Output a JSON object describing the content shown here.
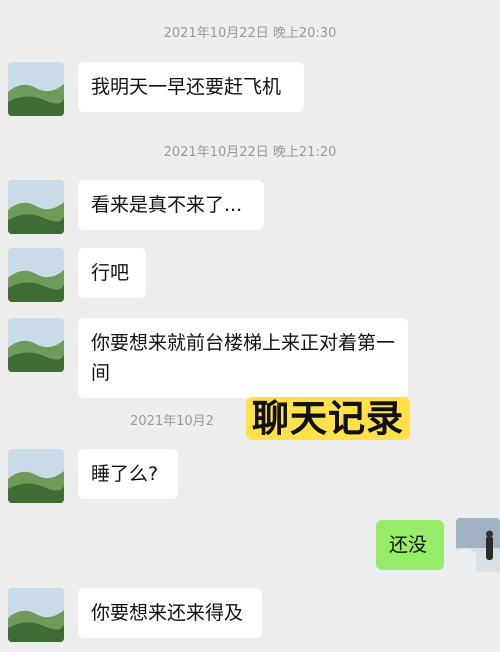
{
  "messages": [
    {
      "type": "time",
      "text": "2021年10月22日 晚上20:30"
    },
    {
      "type": "msg",
      "side": "left",
      "text": "我明天一早还要赶飞机"
    },
    {
      "type": "time",
      "text": "2021年10月22日 晚上21:20"
    },
    {
      "type": "msg",
      "side": "left",
      "text": "看来是真不来了..."
    },
    {
      "type": "msg",
      "side": "left",
      "text": "行吧"
    },
    {
      "type": "msg",
      "side": "left",
      "text": "你要想来就前台楼梯上来正对着第一间"
    },
    {
      "type": "time",
      "text": "2021年10月2"
    },
    {
      "type": "msg",
      "side": "left",
      "text": "睡了么?"
    },
    {
      "type": "msg",
      "side": "right",
      "text": "还没"
    },
    {
      "type": "msg",
      "side": "left",
      "text": "你要想来还来得及"
    }
  ],
  "overlay_caption": "聊天记录",
  "colors": {
    "background": "#ededed",
    "self_bubble": "#95ec69",
    "other_bubble": "#ffffff",
    "caption_bg": "#ffe14a"
  }
}
